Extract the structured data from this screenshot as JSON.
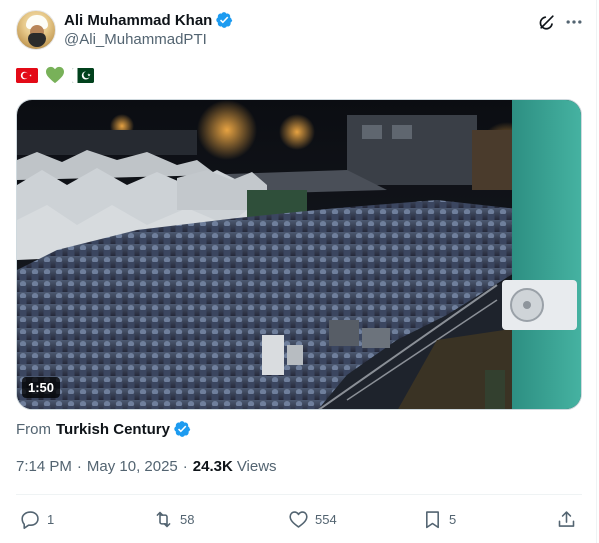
{
  "post": {
    "author_name": "Ali Muhammad Khan",
    "author_handle": "@Ali_MuhammadPTI",
    "text_emojis": [
      "turkey-flag",
      "green-heart",
      "pakistan-flag"
    ],
    "media": {
      "type": "video",
      "duration": "1:50"
    },
    "source": {
      "prefix": "From",
      "name": "Turkish Century"
    },
    "time": "7:14 PM",
    "date": "May 10, 2025",
    "views_count": "24.3K",
    "views_label": "Views",
    "separator": "·"
  },
  "actions": {
    "replies": "1",
    "reposts": "58",
    "likes": "554",
    "bookmarks": "5"
  },
  "colors": {
    "verified_blue": "#1d9bf0",
    "secondary_text": "#536471",
    "primary_text": "#0f1419"
  }
}
